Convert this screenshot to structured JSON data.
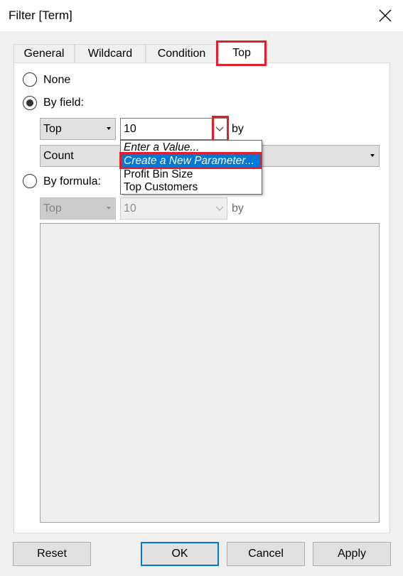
{
  "window": {
    "title": "Filter [Term]"
  },
  "tabs": [
    {
      "label": "General"
    },
    {
      "label": "Wildcard"
    },
    {
      "label": "Condition"
    },
    {
      "label": "Top"
    }
  ],
  "options": {
    "none_label": "None",
    "by_field_label": "By field:",
    "by_formula_label": "By formula:",
    "selected": "by_field"
  },
  "by_field": {
    "direction": "Top",
    "count_value": "10",
    "by_label": "by",
    "aggregation": "Count"
  },
  "dropdown": {
    "items": [
      {
        "label": "Enter a Value...",
        "italic": true
      },
      {
        "label": "Create a New Parameter...",
        "italic": true,
        "selected": true
      },
      {
        "label": "Profit Bin Size"
      },
      {
        "label": "Top Customers"
      }
    ]
  },
  "by_formula": {
    "direction": "Top",
    "count_value": "10",
    "by_label": "by",
    "formula_text": ""
  },
  "buttons": {
    "reset": "Reset",
    "ok": "OK",
    "cancel": "Cancel",
    "apply": "Apply"
  },
  "colors": {
    "highlight": "#e0202d",
    "selection": "#0078d7"
  }
}
